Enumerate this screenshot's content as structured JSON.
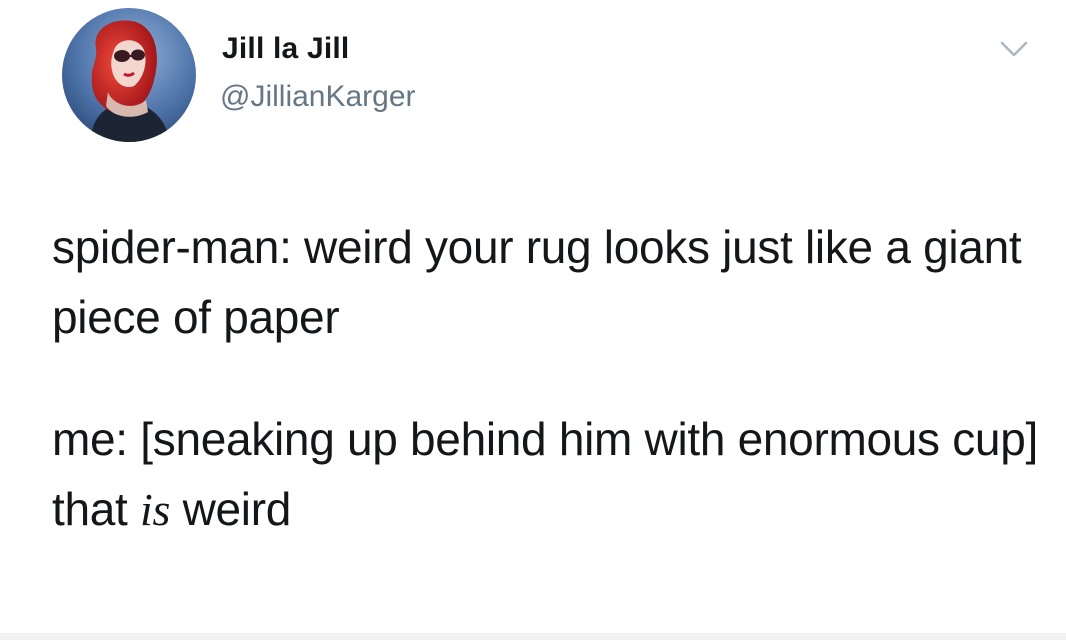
{
  "author": {
    "display_name": "Jill la Jill",
    "handle": "@JillianKarger"
  },
  "icons": {
    "menu": "chevron-down-icon",
    "avatar": "profile-photo"
  },
  "tweet": {
    "paragraph_1": "spider-man: weird your rug looks just like a giant piece of paper",
    "paragraph_2_before": "me: [sneaking up behind him with enormous cup] that ",
    "paragraph_2_emphasis": "is",
    "paragraph_2_after": " weird"
  },
  "colors": {
    "text": "#14171a",
    "handle": "#657786",
    "chevron": "#aab8c2"
  }
}
